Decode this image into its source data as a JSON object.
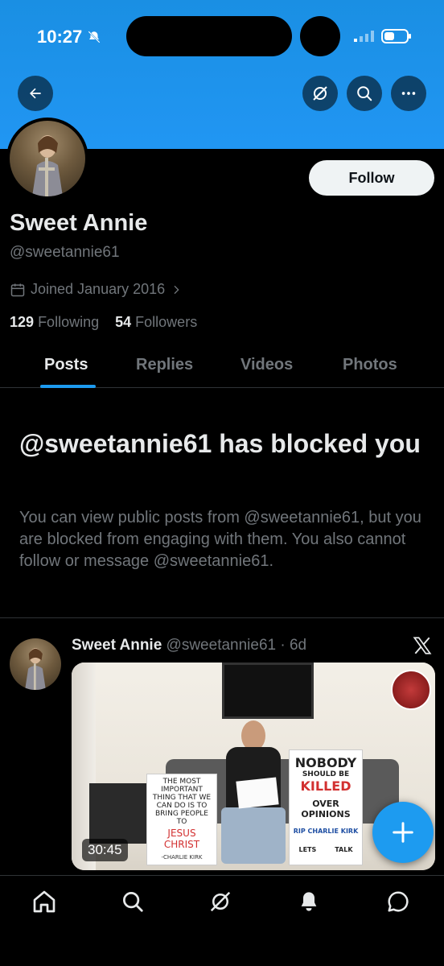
{
  "status_bar": {
    "time": "10:27"
  },
  "profile": {
    "display_name": "Sweet Annie",
    "handle": "@sweetannie61",
    "joined": "Joined January 2016",
    "following_count": "129",
    "following_label": "Following",
    "followers_count": "54",
    "followers_label": "Followers",
    "follow_label": "Follow"
  },
  "tabs": [
    {
      "label": "Posts",
      "active": true
    },
    {
      "label": "Replies",
      "active": false
    },
    {
      "label": "Videos",
      "active": false
    },
    {
      "label": "Photos",
      "active": false
    }
  ],
  "blocked": {
    "title": "@sweetannie61 has blocked you",
    "description": "You can view public posts from @sweetannie61, but you are blocked from engaging with them. You also cannot follow or message @sweetannie61."
  },
  "post": {
    "name": "Sweet Annie",
    "meta": "@sweetannie61 · 6d",
    "video_duration": "30:45",
    "sign_left": {
      "text": "THE MOST IMPORTANT THING THAT WE CAN DO IS TO BRING PEOPLE TO",
      "highlight": "JESUS CHRIST",
      "signature": "-CHARLIE KIRK"
    },
    "sign_right": {
      "line1": "NOBODY",
      "line2": "SHOULD BE",
      "line3": "KILLED",
      "line4": "OVER OPINIONS",
      "line5": "RIP CHARLIE KIRK",
      "line6a": "LETS",
      "line6b": "TALK"
    }
  },
  "colors": {
    "banner": "#2196f3",
    "accent": "#1d9bf0",
    "muted_text": "#71767b",
    "primary_text": "#e7e9ea"
  },
  "icons": {
    "back": "arrow-left-icon",
    "grok": "grok-icon",
    "search": "search-icon",
    "more": "more-icon",
    "nav": [
      "home-icon",
      "search-icon",
      "grok-icon",
      "notifications-icon",
      "messages-icon"
    ]
  }
}
